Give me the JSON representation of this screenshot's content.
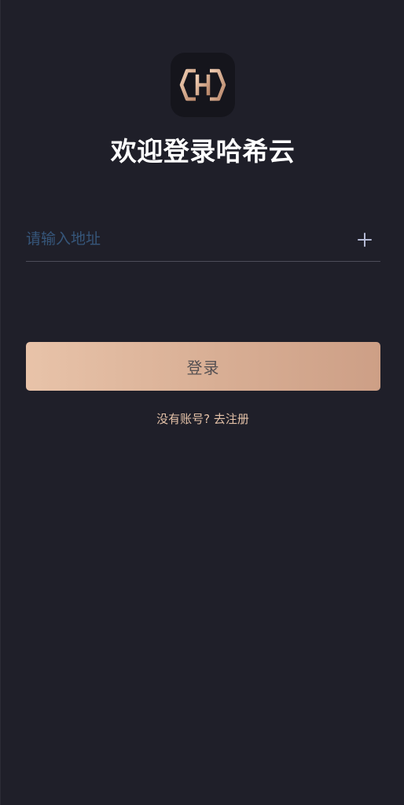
{
  "app": {
    "title": "欢迎登录哈希云",
    "logo_icon": "hexagon-h-logo-icon",
    "accent_color": "#d8ae94"
  },
  "address": {
    "value": "",
    "placeholder": "请输入地址",
    "add_icon": "plus-icon"
  },
  "login": {
    "button_label": "登录"
  },
  "register": {
    "link_text": "没有账号? 去注册"
  }
}
